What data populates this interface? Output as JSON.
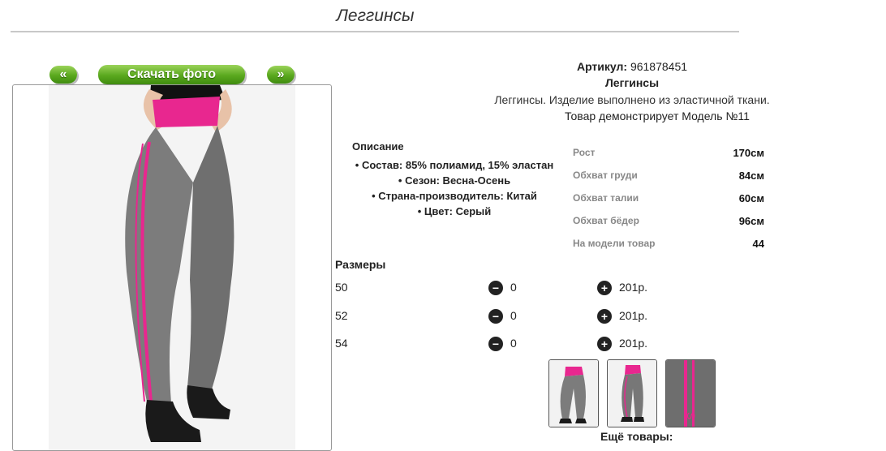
{
  "page": {
    "title": "Леггинсы"
  },
  "gallery": {
    "prev_label": "«",
    "download_label": "Скачать фото",
    "next_label": "»"
  },
  "product": {
    "article_label": "Артикул:",
    "article_value": "961878451",
    "name": "Леггинсы",
    "description": "Леггинсы. Изделие выполнено из эластичной ткани.",
    "model_note": "Товар демонстрирует Модель №11"
  },
  "details": {
    "heading": "Описание",
    "items": [
      "• Состав: 85% полиамид, 15% эластан",
      "• Сезон: Весна-Осень",
      "• Страна-производитель: Китай",
      "• Цвет: Серый"
    ]
  },
  "measurements": [
    {
      "label": "Рост",
      "value": "170см"
    },
    {
      "label": "Обхват груди",
      "value": "84см"
    },
    {
      "label": "Обхват талии",
      "value": "60см"
    },
    {
      "label": "Обхват бёдер",
      "value": "96см"
    },
    {
      "label": "На модели товар",
      "value": "44"
    }
  ],
  "sizes": {
    "heading": "Размеры",
    "rows": [
      {
        "size": "50",
        "qty": "0",
        "price": "201р."
      },
      {
        "size": "52",
        "qty": "0",
        "price": "201р."
      },
      {
        "size": "54",
        "qty": "0",
        "price": "201р."
      }
    ]
  },
  "more_label": "Ещё товары:",
  "colors": {
    "leggings": "#7c7c7c",
    "accent": "#e8278f",
    "button_green": "#5aa81e"
  }
}
